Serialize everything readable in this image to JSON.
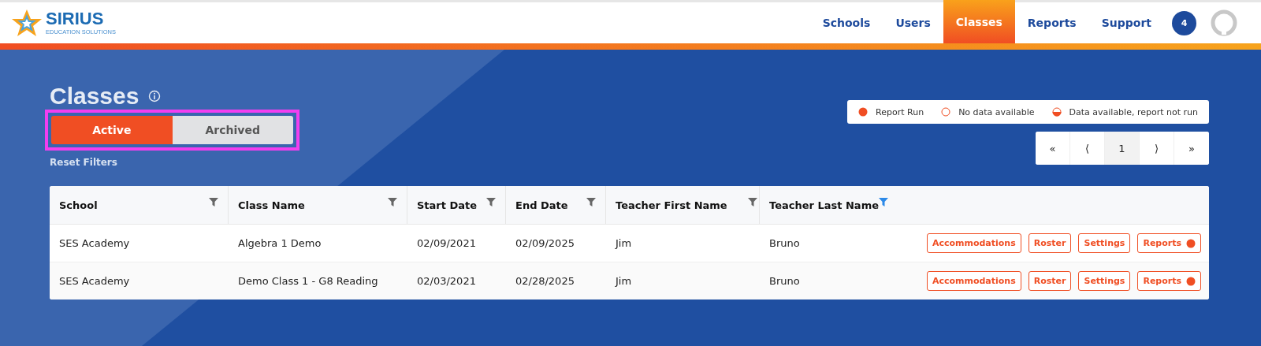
{
  "brand": {
    "name": "SIRIUS",
    "tagline": "EDUCATION SOLUTIONS"
  },
  "nav": [
    {
      "label": "Schools",
      "selected": false
    },
    {
      "label": "Users",
      "selected": false
    },
    {
      "label": "Classes",
      "selected": true
    },
    {
      "label": "Reports",
      "selected": false
    },
    {
      "label": "Support",
      "selected": false
    }
  ],
  "notifications": "4",
  "page_title": "Classes",
  "toggle": [
    {
      "label": "Active",
      "selected": true
    },
    {
      "label": "Archived",
      "selected": false
    }
  ],
  "reset_filters": "Reset Filters",
  "legend": [
    {
      "kind": "run",
      "label": "Report Run"
    },
    {
      "kind": "none",
      "label": "No data available"
    },
    {
      "kind": "partial",
      "label": "Data available, report not run"
    }
  ],
  "pagination": [
    {
      "label": "«",
      "selected": false
    },
    {
      "label": "⟨",
      "selected": false
    },
    {
      "label": "1",
      "selected": true
    },
    {
      "label": "⟩",
      "selected": false
    },
    {
      "label": "»",
      "selected": false
    }
  ],
  "table": {
    "columns": [
      {
        "label": "School",
        "filter_active": false
      },
      {
        "label": "Class Name",
        "filter_active": false
      },
      {
        "label": "Start Date",
        "filter_active": false
      },
      {
        "label": "End Date",
        "filter_active": false
      },
      {
        "label": "Teacher First Name",
        "filter_active": false
      },
      {
        "label": "Teacher Last Name",
        "filter_active": true
      }
    ],
    "rows": [
      {
        "cells": [
          "SES Academy",
          "Algebra 1 Demo",
          "02/09/2021",
          "02/09/2025",
          "Jim",
          "Bruno"
        ],
        "actions": [
          "Accommodations",
          "Roster",
          "Settings",
          "Reports"
        ],
        "report_run": true
      },
      {
        "cells": [
          "SES Academy",
          "Demo Class 1 - G8 Reading",
          "02/03/2021",
          "02/28/2025",
          "Jim",
          "Bruno"
        ],
        "actions": [
          "Accommodations",
          "Roster",
          "Settings",
          "Reports"
        ],
        "report_run": true
      }
    ]
  }
}
